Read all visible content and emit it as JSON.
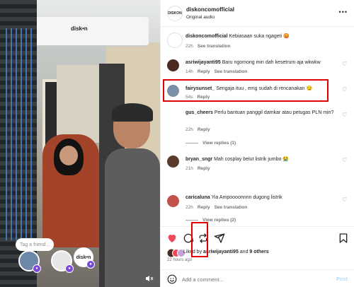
{
  "video": {
    "ac_logo": "disk•n",
    "tag_friend_placeholder": "Tag a friend...",
    "bubble_logo": "disk•n"
  },
  "post": {
    "username": "diskoncomofficial",
    "audio": "Original audio",
    "more": "•••",
    "avatar_logo": "DISKON"
  },
  "comments": [
    {
      "user": "diskoncomofficial",
      "text": " Kebiasaan suka ngageti 😡",
      "time": "22h",
      "actions": [
        "See translation"
      ]
    },
    {
      "user": "asriwijayanti95",
      "text": " Baru ngomong min dah kesetrum aja wkwkw",
      "time": "14h",
      "actions": [
        "Reply",
        "See translation"
      ]
    },
    {
      "user": "fairysunset_",
      "text": " Sengaja ituu , emg sudah di rencanakan 😏",
      "time": "54s",
      "actions": [
        "Reply"
      ]
    },
    {
      "user": "gus_cheers",
      "text": " Perlu bantuan panggil damkar atau petugas PLN min?",
      "time": "22h",
      "actions": [
        "Reply"
      ],
      "replies": "View replies (1)"
    },
    {
      "user": "bryan_sngr",
      "text": " Mah cosplay belut listrik jumbo 😭",
      "time": "21h",
      "actions": [
        "Reply"
      ]
    },
    {
      "user": "caricaluna",
      "text": " Yia Ampoooonnnn dugong listrik",
      "time": "22h",
      "actions": [
        "Reply",
        "See translation"
      ],
      "replies": "View replies (2)"
    }
  ],
  "liked_by": {
    "prefix": "Liked by ",
    "user": "asriwijayanti95",
    "mid": " and ",
    "others": "9 others"
  },
  "time_ago": "22 hours ago",
  "add_comment": {
    "placeholder": "Add a comment...",
    "post_label": "Post"
  },
  "colors": {
    "highlight": "#e00000",
    "like": "#ed4956",
    "post_disabled": "#b3dbff"
  }
}
